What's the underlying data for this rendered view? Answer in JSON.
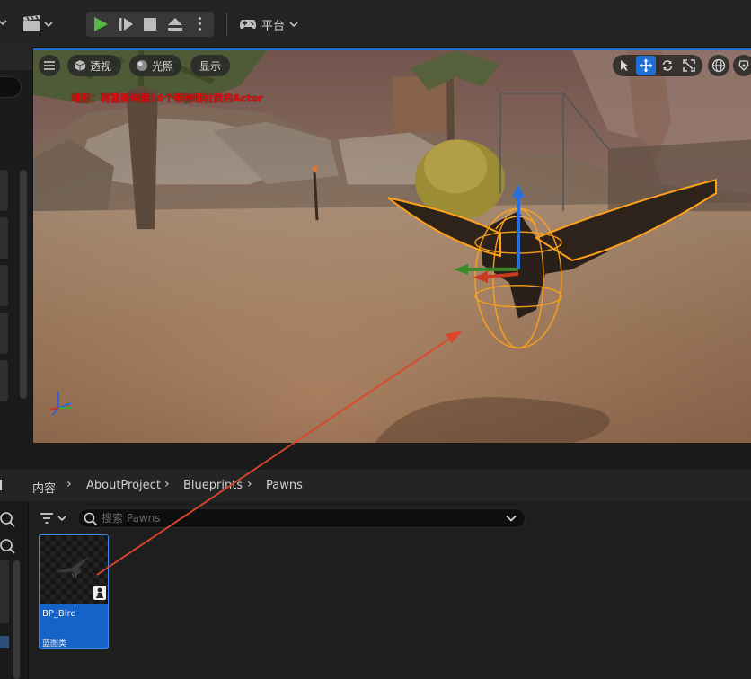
{
  "toolbar": {
    "platform_label": "平台",
    "icons": [
      "chevron-down-icon",
      "clapperboard-icon",
      "play-icon",
      "skip-frame-icon",
      "stop-icon",
      "eject-icon",
      "more-vertical-icon",
      "gamepad-icon"
    ],
    "play_color": "#55b842"
  },
  "viewport": {
    "perspective_label": "透视",
    "lit_label": "光照",
    "show_label": "显示",
    "warning_text": "地形：将重新构建16个带物理材质的Actor",
    "warning_color": "#e01010",
    "active_tool": "move",
    "tools": [
      "select-icon",
      "move-icon",
      "rotate-icon",
      "scale-icon"
    ],
    "accent": "#1f6fd6"
  },
  "content_browser": {
    "breadcrumbs": [
      "内容",
      "AboutProject",
      "Blueprints",
      "Pawns"
    ],
    "search_placeholder": "搜索 Pawns",
    "assets": [
      {
        "name": "BP_Bird",
        "type": "蓝图类",
        "badge": "pawn-icon"
      }
    ]
  },
  "annotation": {
    "arrow_color": "#e0442a"
  }
}
